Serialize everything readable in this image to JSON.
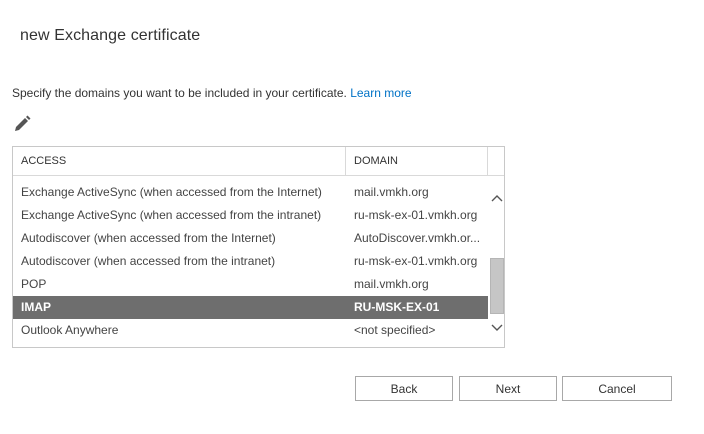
{
  "dialog": {
    "title": "new Exchange certificate",
    "description": "Specify the domains you want to be included in your certificate.",
    "learn_more": "Learn more"
  },
  "toolbar": {
    "edit_icon": "pencil-icon"
  },
  "table": {
    "headers": {
      "access": "ACCESS",
      "domain": "DOMAIN"
    },
    "rows": [
      {
        "access": "Exchange ActiveSync (when accessed from the Internet)",
        "domain": "mail.vmkh.org"
      },
      {
        "access": "Exchange ActiveSync (when accessed from the intranet)",
        "domain": "ru-msk-ex-01.vmkh.org"
      },
      {
        "access": "Autodiscover (when accessed from the Internet)",
        "domain": "AutoDiscover.vmkh.or..."
      },
      {
        "access": "Autodiscover (when accessed from the intranet)",
        "domain": "ru-msk-ex-01.vmkh.org"
      },
      {
        "access": "POP",
        "domain": "mail.vmkh.org"
      },
      {
        "access": "IMAP",
        "domain": "RU-MSK-EX-01",
        "selected": true
      },
      {
        "access": "Outlook Anywhere",
        "domain": "<not specified>"
      }
    ]
  },
  "buttons": {
    "back": "Back",
    "next": "Next",
    "cancel": "Cancel"
  },
  "colors": {
    "link": "#0072c6",
    "selected_row": "#6e6e6e"
  }
}
